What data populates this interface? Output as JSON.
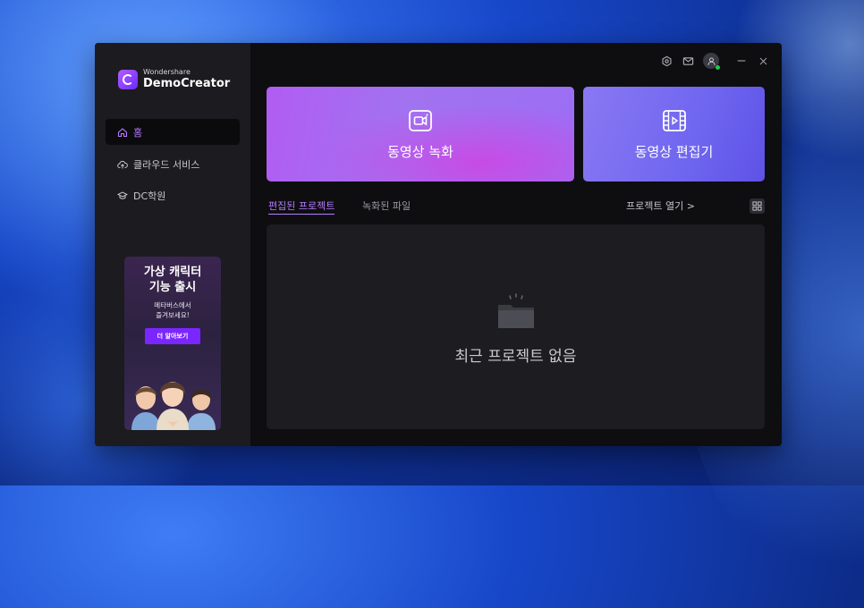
{
  "app": {
    "brand_small": "Wondershare",
    "brand_name": "DemoCreator"
  },
  "sidebar": {
    "items": [
      {
        "label": "홈",
        "icon": "home-icon",
        "active": true
      },
      {
        "label": "클라우드 서비스",
        "icon": "cloud-upload-icon",
        "active": false
      },
      {
        "label": "DC학원",
        "icon": "graduation-cap-icon",
        "active": false
      }
    ],
    "promo": {
      "title_line1": "가상 캐릭터",
      "title_line2": "기능 출시",
      "sub_line1": "메타버스에서",
      "sub_line2": "즐겨보세요!",
      "button": "더 알아보기"
    }
  },
  "topbar": {
    "icons": [
      "settings-icon",
      "mail-icon",
      "user-avatar-icon",
      "minimize-icon",
      "close-icon"
    ]
  },
  "cards": {
    "record_label": "동영상 녹화",
    "edit_label": "동영상 편집기"
  },
  "tabs": {
    "edited": "편집된 프로젝트",
    "recorded": "녹화된 파일"
  },
  "open_project": "프로젝트 열기 >",
  "empty_state": "최근 프로젝트 없음",
  "colors": {
    "accent": "#b67bff",
    "record_card": "#b15cf2",
    "edit_card": "#6f66f0",
    "promo_button": "#7b26ff"
  }
}
